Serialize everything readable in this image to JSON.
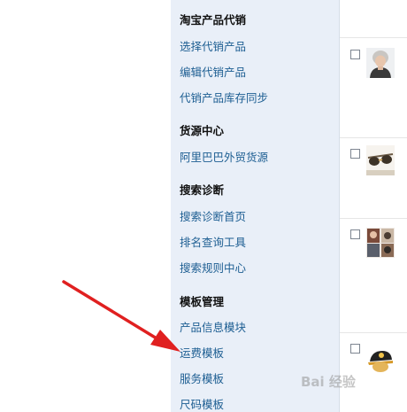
{
  "sidebar": {
    "sections": [
      {
        "heading": "淘宝产品代销",
        "links": [
          "选择代销产品",
          "编辑代销产品",
          "代销产品库存同步"
        ]
      },
      {
        "heading": "货源中心",
        "links": [
          "阿里巴巴外贸货源"
        ]
      },
      {
        "heading": "搜索诊断",
        "links": [
          "搜索诊断首页",
          "排名查询工具",
          "搜索规则中心"
        ]
      },
      {
        "heading": "模板管理",
        "links": [
          "产品信息模块",
          "运费模板",
          "服务模板",
          "尺码模板"
        ]
      }
    ]
  },
  "product_rows": [
    {
      "thumbnail": "woman-knit-hat-photo",
      "checked": false
    },
    {
      "thumbnail": "sunglasses-photo",
      "checked": false
    },
    {
      "thumbnail": "hats-collage-photo",
      "checked": false
    },
    {
      "thumbnail": "cap-photo",
      "checked": false
    }
  ],
  "annotation": {
    "arrow_color": "#e02020",
    "points_to": "运费模板"
  },
  "watermark": {
    "text": "Bai 经验"
  },
  "colors": {
    "sidebar_bg": "#e9eff8",
    "link": "#1d5e92",
    "heading": "#111111"
  }
}
